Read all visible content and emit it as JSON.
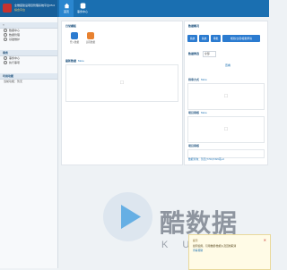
{
  "brand": {
    "line1": "全维度建设项目管理系统平台V5.0",
    "line2": "综合平台"
  },
  "topnav": {
    "home_label": "首页",
    "business_label": "事务中心"
  },
  "sidebar": {
    "section1_items": [
      {
        "label": "数据中心"
      },
      {
        "label": "数据管理"
      },
      {
        "label": "基础维护"
      }
    ],
    "section2_title": "事务",
    "section2_items": [
      {
        "label": "事务中心"
      },
      {
        "label": "执行事项"
      }
    ],
    "section3_title": "可用功能",
    "section3_note": "当前功能：暂无"
  },
  "panels": {
    "quick_title": "日常模板",
    "quick_items": [
      {
        "label": "登入数据"
      },
      {
        "label": "远程数据"
      }
    ],
    "recent_title": "最新数据",
    "recent_more": "More",
    "data_title": "数据概况",
    "data_buttons": [
      "系统",
      "系统",
      "审批",
      "规划/立项/报批申请"
    ],
    "filter_label": "数据筛选",
    "filter_value": "全部",
    "filter_link": "查看",
    "review_title": "待审方式",
    "review_more": "More",
    "project_title": "项目审核",
    "project_more": "More",
    "monthly_title": "项目审核",
    "footer_note": "数据查询：暂无(7700)7/8/0项+0"
  },
  "watermark": {
    "text": "酷数据",
    "sub": "KUIDC"
  },
  "popup": {
    "title": "提示",
    "message": "如何使用，引用数据/数据以及回档取消",
    "link": "查看帮助"
  },
  "colors": {
    "topbar": "#1a6fb1",
    "accent": "#2b7bd0",
    "logo": "#c6322e"
  }
}
